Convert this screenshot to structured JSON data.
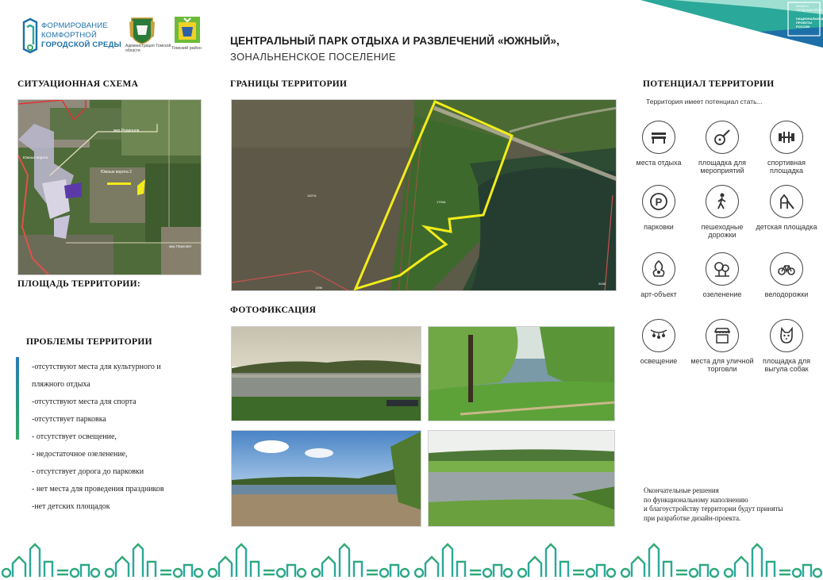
{
  "header": {
    "program_logo_lines": [
      "ФОРМИРОВАНИЕ",
      "КОМФОРТНОЙ",
      "ГОРОДСКОЙ СРЕДЫ"
    ],
    "admin_caption": "Администрация Томской области",
    "district_caption": "Томский район",
    "title": "ЦЕНТРАЛЬНЫЙ ПАРК ОТДЫХА И РАЗВЛЕЧЕНИЙ «ЮЖНЫЙ»,",
    "subtitle": "ЗОНАЛЬНЕНСКОЕ ПОСЕЛЕНИЕ",
    "corner_badge": [
      "ЖИЛЬЕ И ГОРОДСКАЯ СРЕДА",
      "НАЦИОНАЛЬНЫЕ ПРОЕКТЫ РОССИИ"
    ]
  },
  "sections": {
    "situational": "СИТУАЦИОННАЯ СХЕМА",
    "area": "ПЛОЩАДЬ ТЕРРИТОРИИ:",
    "problems": "ПРОБЛЕМЫ ТЕРРИТОРИИ",
    "borders": "ГРАНИЦЫ ТЕРРИТОРИИ",
    "photos": "ФОТОФИКСАЦИЯ",
    "potential": "ПОТЕНЦИАЛ ТЕРРИТОРИИ"
  },
  "map_labels": {
    "south_gate": "Южные ворота 2",
    "rodionov": "мкр Родионов",
    "south_gate_left": "Южные ворота",
    "peresvet": "мкр Пересвет",
    "parcel_left": "1927А",
    "parcel_center": "1794А",
    "parcel_bottom": "1396",
    "parcel_right": "2048"
  },
  "problems": [
    "-отсутствуют места для культурного и",
    "пляжного отдыха",
    "-отсутствуют места для спорта",
    "-отсутствует парковка",
    "- отсутствует освещение,",
    "- недостаточное озеленение,",
    "- отсутствует дорога до парковки",
    "- нет места для проведения праздников",
    "-нет детских площадок"
  ],
  "potential": {
    "intro": "Территория имеет потенциал стать...",
    "items": [
      {
        "icon": "bench-icon",
        "label": "места отдыха"
      },
      {
        "icon": "guitar-icon",
        "label": "площадка для мероприятий"
      },
      {
        "icon": "dumbbell-icon",
        "label": "спортивная площадка"
      },
      {
        "icon": "parking-icon",
        "label": "парковки"
      },
      {
        "icon": "pedestrian-icon",
        "label": "пешеходные дорожки"
      },
      {
        "icon": "playground-icon",
        "label": "детская площадка"
      },
      {
        "icon": "art-object-icon",
        "label": "арт-объект"
      },
      {
        "icon": "trees-icon",
        "label": "озеленение"
      },
      {
        "icon": "bicycle-icon",
        "label": "велодорожки"
      },
      {
        "icon": "lights-icon",
        "label": "освещение"
      },
      {
        "icon": "kiosk-icon",
        "label": "места для уличной торговли"
      },
      {
        "icon": "dog-icon",
        "label": "площадка для выгула собак"
      }
    ],
    "final_note": [
      "Окончательные решения",
      "по функциональному наполнению",
      "и благоустройству территории будут приняты",
      "при разработке дизайн-проекта."
    ]
  },
  "colors": {
    "brand_blue": "#1d6fa8",
    "brand_teal": "#2aa89a",
    "brand_green": "#34a866",
    "boundary_yellow": "#f2ec1a"
  }
}
